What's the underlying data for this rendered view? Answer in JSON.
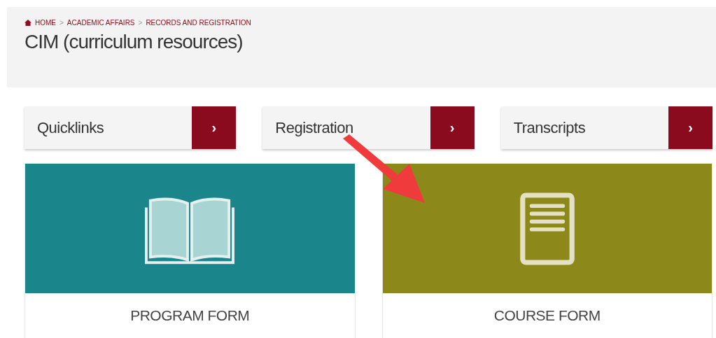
{
  "breadcrumb": [
    "HOME",
    "ACADEMIC AFFAIRS",
    "RECORDS AND REGISTRATION"
  ],
  "breadcrumb_separator": ">",
  "title": "CIM (curriculum resources)",
  "quicklinks": [
    {
      "label": "Quicklinks",
      "arrow": "›"
    },
    {
      "label": "Registration",
      "arrow": "›"
    },
    {
      "label": "Transcripts",
      "arrow": "›"
    }
  ],
  "cards": [
    {
      "label": "PROGRAM FORM",
      "kind": "book",
      "color": "#1a868c"
    },
    {
      "label": "COURSE FORM",
      "kind": "document",
      "color": "#8c891a"
    }
  ]
}
